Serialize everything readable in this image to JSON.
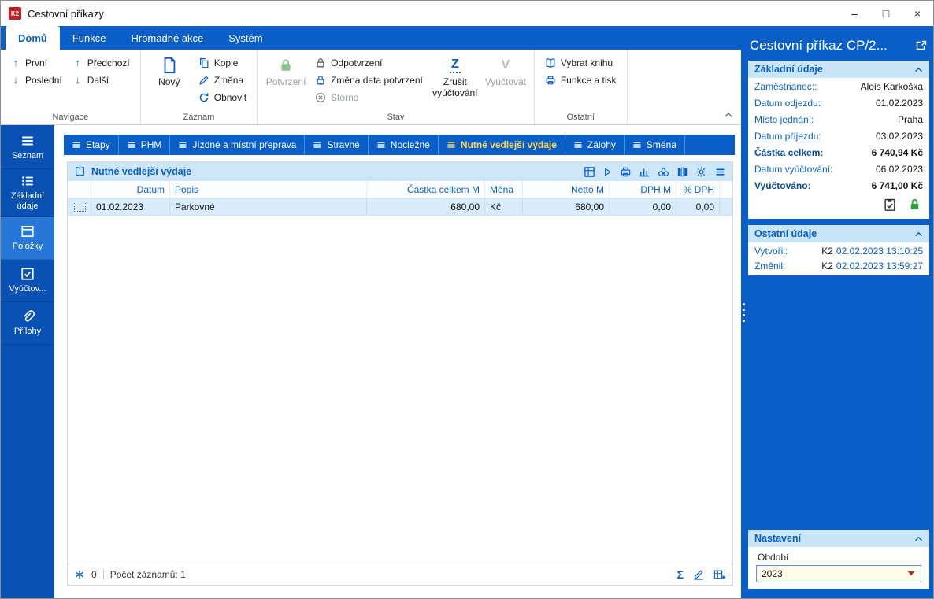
{
  "colors": {
    "accent": "#0a5ec7",
    "sidebar": "#0a51b4",
    "sidebar-active": "#2677d8",
    "tab-yellow": "#ffd44d",
    "sel-row": "#d8ecfb",
    "hdr-bg": "#cde7f9",
    "green": "#2f9e3f",
    "combo-arrow": "#a03030"
  },
  "titlebar": {
    "logo": "K2",
    "title": "Cestovní příkazy",
    "minimize": "–",
    "maximize": "□",
    "close": "×"
  },
  "ribbon": {
    "tabs": [
      {
        "label": "Domů"
      },
      {
        "label": "Funkce"
      },
      {
        "label": "Hromadné akce"
      },
      {
        "label": "Systém"
      }
    ],
    "groups": {
      "navigace": {
        "label": "Navigace",
        "first": "První",
        "last": "Poslední",
        "previous": "Předchozí",
        "next": "Další"
      },
      "zaznam": {
        "label": "Záznam",
        "new": "Nový",
        "copy": "Kopie",
        "change": "Změna",
        "refresh": "Obnovit"
      },
      "stav": {
        "label": "Stav",
        "confirm": "Potvrzení",
        "unconfirm": "Odpotvrzení",
        "change_confirm_date": "Změna data potvrzení",
        "storno": "Storno",
        "cancel_settlement": "Zrušit vyúčtování",
        "cancel_settlement_glyph": "Z",
        "settle": "Vyúčtovat",
        "settle_glyph": "V"
      },
      "ostatni": {
        "label": "Ostatní",
        "select_book": "Vybrat knihu",
        "functions_print": "Funkce a tisk"
      }
    }
  },
  "sidebar": {
    "items": [
      {
        "label": "Seznam"
      },
      {
        "label": "Základní údaje"
      },
      {
        "label": "Položky"
      },
      {
        "label": "Vyúčtov..."
      },
      {
        "label": "Přílohy"
      }
    ]
  },
  "content": {
    "tabs": [
      {
        "label": "Etapy"
      },
      {
        "label": "PHM"
      },
      {
        "label": "Jízdné a místní přeprava"
      },
      {
        "label": "Stravné"
      },
      {
        "label": "Nocležné"
      },
      {
        "label": "Nutné vedlejší výdaje"
      },
      {
        "label": "Zálohy"
      },
      {
        "label": "Směna"
      }
    ],
    "panel": {
      "title": "Nutné vedlejší výdaje",
      "table": {
        "columns": [
          "Datum",
          "Popis",
          "Částka celkem M",
          "Měna",
          "Netto M",
          "DPH M",
          "% DPH"
        ],
        "rows": [
          [
            "01.02.2023",
            "Parkovné",
            "680,00",
            "Kč",
            "680,00",
            "0,00",
            "0,00"
          ]
        ]
      },
      "footer": {
        "filter_count": "0",
        "records": "Počet záznamů: 1",
        "sum_glyph": "Σ"
      }
    }
  },
  "right_panel": {
    "title": "Cestovní příkaz CP/2...",
    "basic": {
      "header": "Základní údaje",
      "fields": [
        {
          "label": "Zaměstnanec::",
          "value": "Alois Karkoška"
        },
        {
          "label": "Datum odjezdu:",
          "value": "01.02.2023"
        },
        {
          "label": "Místo jednání:",
          "value": "Praha"
        },
        {
          "label": "Datum příjezdu:",
          "value": "03.02.2023"
        },
        {
          "label": "Částka celkem:",
          "value": "6 740,94 Kč"
        },
        {
          "label": "Datum vyúčtování:",
          "value": "06.02.2023"
        },
        {
          "label": "Vyúčtováno:",
          "value": "6 741,00 Kč"
        }
      ]
    },
    "other": {
      "header": "Ostatní údaje",
      "fields": [
        {
          "label": "Vytvořil:",
          "user": "K2",
          "timestamp": "02.02.2023 13:10:25"
        },
        {
          "label": "Změnil:",
          "user": "K2",
          "timestamp": "02.02.2023 13:59:27"
        }
      ]
    },
    "settings": {
      "header": "Nastavení",
      "period_label": "Období",
      "period_value": "2023"
    }
  }
}
